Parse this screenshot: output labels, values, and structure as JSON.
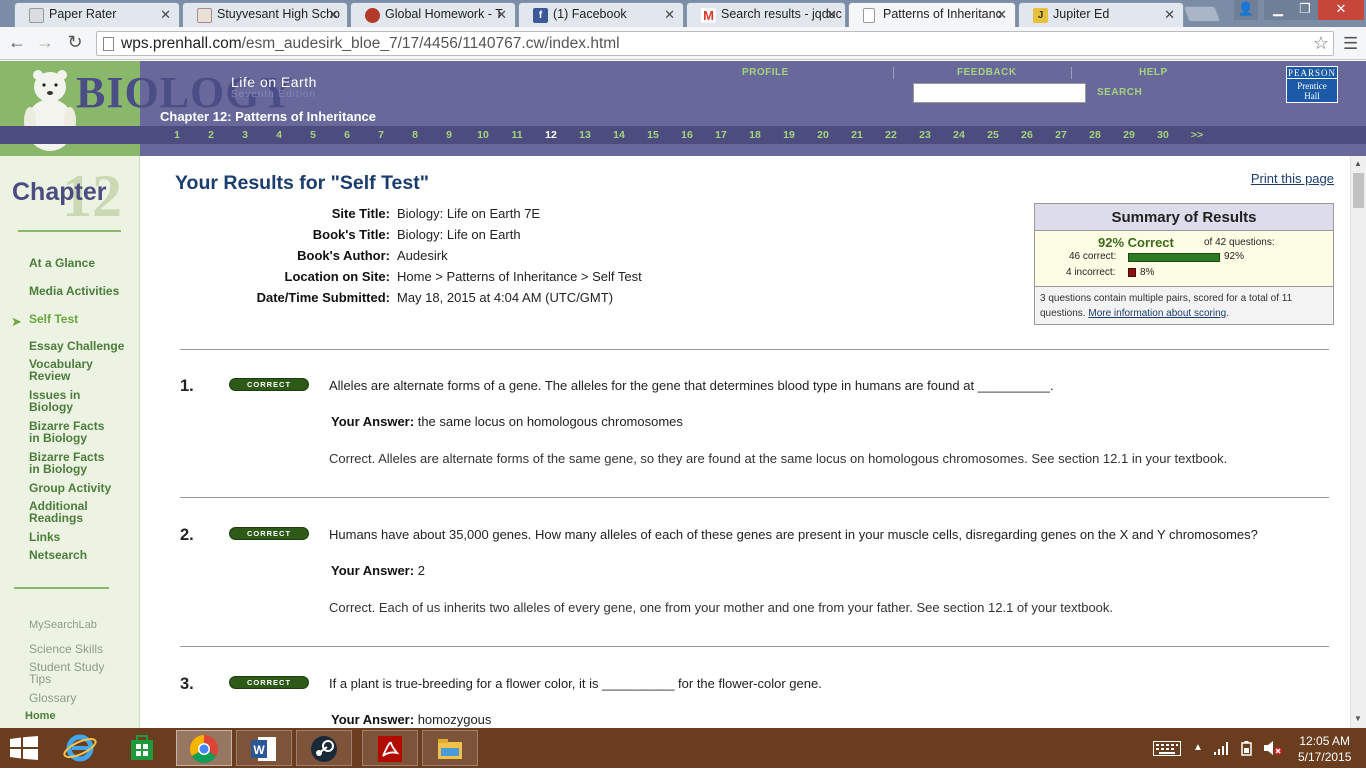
{
  "browser": {
    "tabs": [
      {
        "title": "Paper Rater",
        "icon": "paper-rater-icon"
      },
      {
        "title": "Stuyvesant High Scho",
        "icon": "stuyvesant-icon"
      },
      {
        "title": "Global Homework - T",
        "icon": "global-homework-icon"
      },
      {
        "title": "(1) Facebook",
        "icon": "facebook-icon"
      },
      {
        "title": "Search results - jqduc",
        "icon": "gmail-icon"
      },
      {
        "title": "Patterns of Inheritanc",
        "icon": "page-icon"
      },
      {
        "title": "Jupiter Ed",
        "icon": "jupiter-ed-icon"
      }
    ],
    "url_domain": "wps.prenhall.com",
    "url_path": "/esm_audesirk_bloe_7/17/4456/1140767.cw/index.html"
  },
  "header": {
    "title": "BIOLOGY",
    "subtitle": "Life on Earth",
    "edition": "Seventh Edition",
    "chapter_heading": "Chapter 12: Patterns of Inheritance",
    "nav": {
      "profile": "PROFILE",
      "feedback": "FEEDBACK",
      "help": "HELP",
      "search": "SEARCH"
    },
    "publisher_1": "PEARSON",
    "publisher_2": "Prentice",
    "publisher_3": "Hall",
    "chapters": [
      "1",
      "2",
      "3",
      "4",
      "5",
      "6",
      "7",
      "8",
      "9",
      "10",
      "11",
      "12",
      "13",
      "14",
      "15",
      "16",
      "17",
      "18",
      "19",
      "20",
      "21",
      "22",
      "23",
      "24",
      "25",
      "26",
      "27",
      "28",
      "29",
      "30",
      ">>"
    ],
    "current_chapter": "12"
  },
  "sidebar": {
    "chapter_word": "Chapter",
    "chapter_number": "12",
    "items": [
      {
        "l1": "At a Glance",
        "l2": ""
      },
      {
        "l1": "Media Activities",
        "l2": ""
      },
      {
        "l1": "Self Test",
        "l2": ""
      },
      {
        "l1": "Essay Challenge",
        "l2": ""
      },
      {
        "l1": "Vocabulary",
        "l2": "Review"
      },
      {
        "l1": "Issues in",
        "l2": "Biology"
      },
      {
        "l1": "Bizarre Facts",
        "l2": "in Biology"
      },
      {
        "l1": "Bizarre Facts",
        "l2": "in Biology"
      },
      {
        "l1": "Group Activity",
        "l2": ""
      },
      {
        "l1": "Additional",
        "l2": "Readings"
      },
      {
        "l1": "Links",
        "l2": ""
      },
      {
        "l1": "Netsearch",
        "l2": ""
      }
    ],
    "resources": [
      {
        "l1": "MySearchLab",
        "l2": ""
      },
      {
        "l1": "Science Skills",
        "l2": ""
      },
      {
        "l1": "Student Study",
        "l2": "Tips"
      },
      {
        "l1": "Glossary",
        "l2": ""
      }
    ],
    "home": "Home"
  },
  "main": {
    "results_title": "Your Results for \"Self Test\"",
    "print_link": "Print this page",
    "info": [
      {
        "label": "Site Title:",
        "value": "Biology: Life on Earth 7E"
      },
      {
        "label": "Book's Title:",
        "value": "Biology: Life on Earth"
      },
      {
        "label": "Book's Author:",
        "value": "Audesirk"
      },
      {
        "label": "Location on Site:",
        "value": "Home > Patterns of Inheritance > Self Test"
      },
      {
        "label": "Date/Time Submitted:",
        "value": "May 18, 2015 at 4:04 AM (UTC/GMT)"
      }
    ],
    "summary": {
      "title": "Summary of Results",
      "percent_text": "92% Correct",
      "of_text": "of 42 questions:",
      "correct_label": "46 correct:",
      "correct_pct": "92%",
      "correct_fraction": 0.92,
      "incorrect_label": "4 incorrect:",
      "incorrect_pct": "8%",
      "incorrect_fraction": 0.08,
      "note": "3 questions contain multiple pairs, scored for a total of 11 questions.",
      "note_link": "More information about scoring",
      "note_end": "."
    },
    "answer_label": "Your Answer:",
    "questions": [
      {
        "num": "1.",
        "status": "CORRECT",
        "text": "Alleles are alternate forms of a gene. The alleles for the gene that determines blood type in humans are found at __________.",
        "answer": "the same locus on homologous chromosomes",
        "feedback": "Correct. Alleles are alternate forms of the same gene, so they are found at the same locus on homologous chromosomes. See section 12.1 in your textbook."
      },
      {
        "num": "2.",
        "status": "CORRECT",
        "text": "Humans have about 35,000 genes. How many alleles of each of these genes are present in your muscle cells, disregarding genes on the X and Y chromosomes?",
        "answer": "2",
        "feedback": "Correct. Each of us inherits two alleles of every gene, one from your mother and one from your father. See section 12.1 of your textbook."
      },
      {
        "num": "3.",
        "status": "CORRECT",
        "text": "If a plant is true-breeding for a flower color, it is __________ for the flower-color gene.",
        "answer": "homozygous",
        "feedback": ""
      }
    ]
  },
  "taskbar": {
    "apps": [
      "internet-explorer-icon",
      "windows-store-icon",
      "chrome-icon",
      "word-icon",
      "steam-icon",
      "acrobat-icon",
      "file-explorer-icon"
    ],
    "time": "12:05 AM",
    "date": "5/17/2015"
  }
}
